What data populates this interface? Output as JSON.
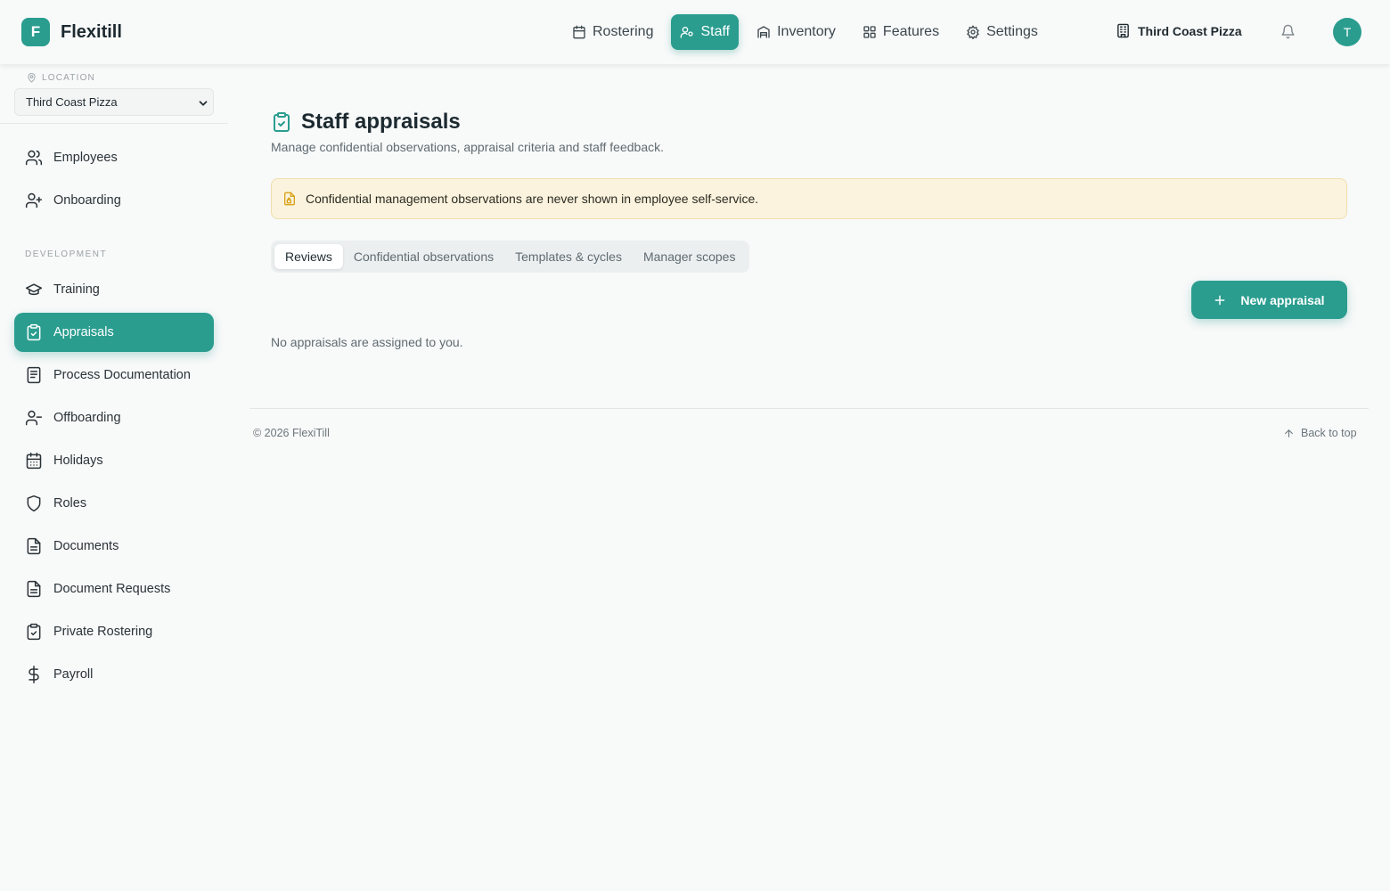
{
  "brand": {
    "logo_letter": "F",
    "name": "Flexitill"
  },
  "nav": [
    {
      "label": "Rostering",
      "icon": "calendar-icon"
    },
    {
      "label": "Staff",
      "icon": "users-icon",
      "active": true
    },
    {
      "label": "Inventory",
      "icon": "warehouse-icon"
    },
    {
      "label": "Features",
      "icon": "grid-icon"
    },
    {
      "label": "Settings",
      "icon": "gear-icon"
    }
  ],
  "store": {
    "name": "Third Coast Pizza"
  },
  "user": {
    "initial": "T"
  },
  "sidebar": {
    "location_label": "LOCATION",
    "location_value": "Third Coast Pizza",
    "items": [
      {
        "label": "Employees",
        "icon": "users-icon"
      },
      {
        "label": "Onboarding",
        "icon": "user-plus-icon"
      }
    ],
    "development_label": "DEVELOPMENT",
    "dev_items": [
      {
        "label": "Training",
        "icon": "graduation-cap-icon"
      },
      {
        "label": "Appraisals",
        "icon": "clipboard-check-icon",
        "active": true
      },
      {
        "label": "Process Documentation",
        "icon": "book-icon"
      },
      {
        "label": "Offboarding",
        "icon": "user-minus-icon"
      },
      {
        "label": "Holidays",
        "icon": "calendar-days-icon"
      },
      {
        "label": "Roles",
        "icon": "shield-icon"
      },
      {
        "label": "Documents",
        "icon": "file-text-icon"
      },
      {
        "label": "Document Requests",
        "icon": "file-request-icon"
      },
      {
        "label": "Private Rostering",
        "icon": "clipboard-check-icon"
      },
      {
        "label": "Payroll",
        "icon": "dollar-icon"
      }
    ]
  },
  "main": {
    "title": "Staff appraisals",
    "subtitle": "Manage confidential observations, appraisal criteria and staff feedback.",
    "notice": "Confidential management observations are never shown in employee self-service.",
    "tabs": [
      "Reviews",
      "Confidential observations",
      "Templates & cycles",
      "Manager scopes"
    ],
    "active_tab": "Reviews",
    "new_button": "New appraisal",
    "empty_text": "No appraisals are assigned to you."
  },
  "footer": {
    "copyright": "© 2026 FlexiTill",
    "back_to_top": "Back to top"
  },
  "colors": {
    "accent": "#2a9d8f",
    "notice_bg": "#fbf3dd",
    "notice_icon": "#d9a21b"
  }
}
